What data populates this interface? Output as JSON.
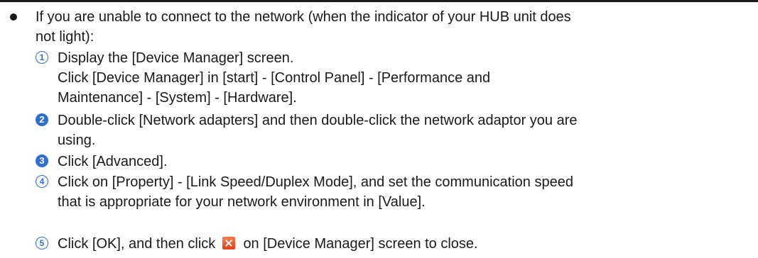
{
  "intro": {
    "line1": "If you are unable to connect to the network (when the indicator of your HUB unit does",
    "line2": "not light):"
  },
  "steps": [
    {
      "number": "1",
      "lines": [
        "Display the [Device Manager] screen.",
        "Click [Device Manager] in [start] - [Control Panel] - [Performance and",
        "Maintenance] - [System] - [Hardware]."
      ]
    },
    {
      "number": "2",
      "lines": [
        "Double-click [Network adapters] and then double-click the network adaptor you are",
        "using."
      ]
    },
    {
      "number": "3",
      "lines": [
        "Click [Advanced]."
      ]
    },
    {
      "number": "4",
      "lines": [
        "Click on [Property] - [Link Speed/Duplex Mode], and set the communication speed",
        "that is appropriate for your network environment in [Value]."
      ]
    },
    {
      "number": "5",
      "before_icon": "Click [OK], and then click",
      "icon": "close-icon",
      "after_icon": "on [Device Manager] screen to close."
    }
  ],
  "colors": {
    "accent": "#2f6fd1",
    "close_icon": "#e0401b"
  }
}
